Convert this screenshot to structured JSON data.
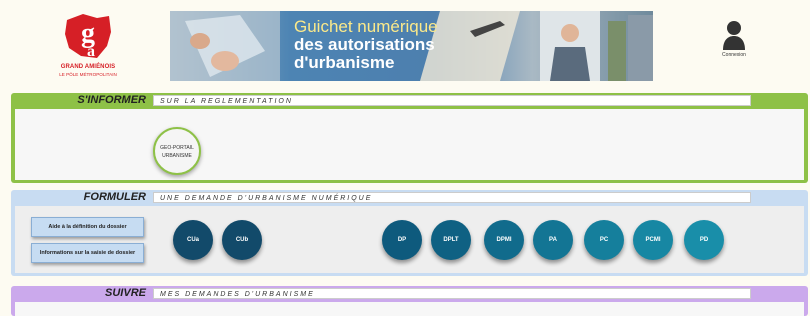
{
  "logo": {
    "line1": "GRAND AMIÉNOIS",
    "line2": "LE PÔLE MÉTROPOLITAIN"
  },
  "banner": {
    "line1": "Guichet numérique",
    "line2": "des autorisations",
    "line3": "d'urbanisme"
  },
  "user": {
    "label": "Connexion",
    "icon": "user-icon"
  },
  "sections": {
    "informer": {
      "title": "S'INFORMER",
      "subtitle": "SUR LA REGLEMENTATION",
      "color": "#8ec147",
      "geo_label_1": "GEO-PORTAIL",
      "geo_label_2": "URBANISME"
    },
    "formuler": {
      "title": "FORMULER",
      "subtitle": "UNE DEMANDE D'URBANISME NUMÉRIQUE",
      "color": "#c8dcf2",
      "aide_label": "Aide à la définition du dossier",
      "info_label": "Informations sur la saisie de dossier",
      "buttons": [
        {
          "label": "CUa",
          "color": "#124a6a"
        },
        {
          "label": "CUb",
          "color": "#124a6a"
        },
        {
          "label": "DP",
          "color": "#0e5a7d"
        },
        {
          "label": "DPLT",
          "color": "#0f6183"
        },
        {
          "label": "DPMI",
          "color": "#116b8c"
        },
        {
          "label": "PA",
          "color": "#137594"
        },
        {
          "label": "PC",
          "color": "#157f9c"
        },
        {
          "label": "PCMI",
          "color": "#1787a3"
        },
        {
          "label": "PD",
          "color": "#198ea9"
        }
      ]
    },
    "suivre": {
      "title": "SUIVRE",
      "subtitle": "MES DEMANDES D'URBANISME",
      "color": "#cba9ec"
    }
  }
}
